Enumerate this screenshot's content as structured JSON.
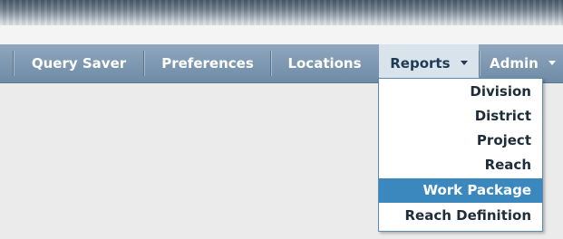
{
  "nav": {
    "items": [
      {
        "label": "Query Saver"
      },
      {
        "label": "Preferences"
      },
      {
        "label": "Locations"
      },
      {
        "label": "Reports"
      },
      {
        "label": "Admin"
      }
    ]
  },
  "reports_menu": {
    "items": [
      {
        "label": "Division"
      },
      {
        "label": "District"
      },
      {
        "label": "Project"
      },
      {
        "label": "Reach"
      },
      {
        "label": "Work Package"
      },
      {
        "label": "Reach Definition"
      }
    ],
    "highlighted": "Work Package"
  },
  "colors": {
    "nav_bg": "#7f99b3",
    "highlight": "#3b88be"
  }
}
